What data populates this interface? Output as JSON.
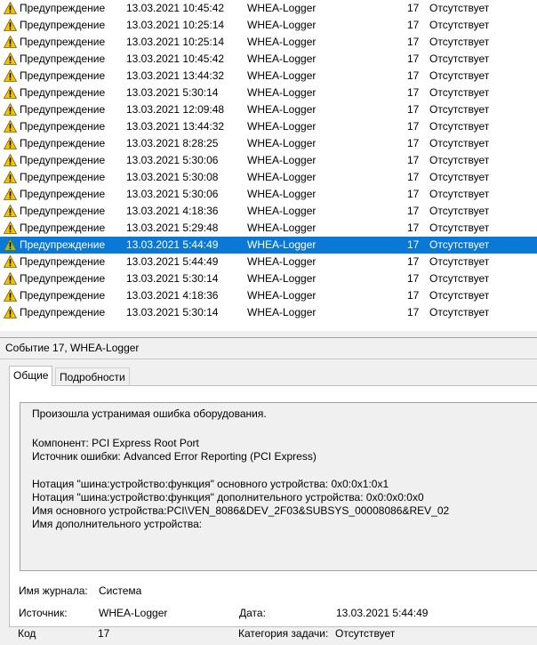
{
  "events": [
    {
      "level": "Предупреждение",
      "date": "13.03.2021 10:45:42",
      "source": "WHEA-Logger",
      "id": "17",
      "task": "Отсутствует",
      "selected": false
    },
    {
      "level": "Предупреждение",
      "date": "13.03.2021 10:25:14",
      "source": "WHEA-Logger",
      "id": "17",
      "task": "Отсутствует",
      "selected": false
    },
    {
      "level": "Предупреждение",
      "date": "13.03.2021 10:25:14",
      "source": "WHEA-Logger",
      "id": "17",
      "task": "Отсутствует",
      "selected": false
    },
    {
      "level": "Предупреждение",
      "date": "13.03.2021 10:45:42",
      "source": "WHEA-Logger",
      "id": "17",
      "task": "Отсутствует",
      "selected": false
    },
    {
      "level": "Предупреждение",
      "date": "13.03.2021 13:44:32",
      "source": "WHEA-Logger",
      "id": "17",
      "task": "Отсутствует",
      "selected": false
    },
    {
      "level": "Предупреждение",
      "date": "13.03.2021 5:30:14",
      "source": "WHEA-Logger",
      "id": "17",
      "task": "Отсутствует",
      "selected": false
    },
    {
      "level": "Предупреждение",
      "date": "13.03.2021 12:09:48",
      "source": "WHEA-Logger",
      "id": "17",
      "task": "Отсутствует",
      "selected": false
    },
    {
      "level": "Предупреждение",
      "date": "13.03.2021 13:44:32",
      "source": "WHEA-Logger",
      "id": "17",
      "task": "Отсутствует",
      "selected": false
    },
    {
      "level": "Предупреждение",
      "date": "13.03.2021 8:28:25",
      "source": "WHEA-Logger",
      "id": "17",
      "task": "Отсутствует",
      "selected": false
    },
    {
      "level": "Предупреждение",
      "date": "13.03.2021 5:30:06",
      "source": "WHEA-Logger",
      "id": "17",
      "task": "Отсутствует",
      "selected": false
    },
    {
      "level": "Предупреждение",
      "date": "13.03.2021 5:30:08",
      "source": "WHEA-Logger",
      "id": "17",
      "task": "Отсутствует",
      "selected": false
    },
    {
      "level": "Предупреждение",
      "date": "13.03.2021 5:30:06",
      "source": "WHEA-Logger",
      "id": "17",
      "task": "Отсутствует",
      "selected": false
    },
    {
      "level": "Предупреждение",
      "date": "13.03.2021 4:18:36",
      "source": "WHEA-Logger",
      "id": "17",
      "task": "Отсутствует",
      "selected": false
    },
    {
      "level": "Предупреждение",
      "date": "13.03.2021 5:29:48",
      "source": "WHEA-Logger",
      "id": "17",
      "task": "Отсутствует",
      "selected": false
    },
    {
      "level": "Предупреждение",
      "date": "13.03.2021 5:44:49",
      "source": "WHEA-Logger",
      "id": "17",
      "task": "Отсутствует",
      "selected": true
    },
    {
      "level": "Предупреждение",
      "date": "13.03.2021 5:44:49",
      "source": "WHEA-Logger",
      "id": "17",
      "task": "Отсутствует",
      "selected": false
    },
    {
      "level": "Предупреждение",
      "date": "13.03.2021 5:30:14",
      "source": "WHEA-Logger",
      "id": "17",
      "task": "Отсутствует",
      "selected": false
    },
    {
      "level": "Предупреждение",
      "date": "13.03.2021 4:18:36",
      "source": "WHEA-Logger",
      "id": "17",
      "task": "Отсутствует",
      "selected": false
    },
    {
      "level": "Предупреждение",
      "date": "13.03.2021 5:30:14",
      "source": "WHEA-Logger",
      "id": "17",
      "task": "Отсутствует",
      "selected": false
    }
  ],
  "icon": "warning-icon",
  "colors": {
    "selection": "#0a78d7",
    "warning": "#f5c400"
  },
  "details": {
    "title": "Событие 17, WHEA-Logger",
    "tabs": {
      "general": "Общие",
      "details": "Подробности"
    },
    "description": {
      "line1": "Произошла устранимая ошибка оборудования.",
      "line2": "Компонент: PCI Express Root Port",
      "line3": "Источник ошибки: Advanced Error Reporting (PCI Express)",
      "line4": "Нотация \"шина:устройство:функция\" основного устройства: 0x0:0x1:0x1",
      "line5": "Нотация \"шина:устройство:функция\" дополнительного устройства: 0x0:0x0:0x0",
      "line6": "Имя основного устройства:PCI\\VEN_8086&DEV_2F03&SUBSYS_00008086&REV_02",
      "line7": "Имя дополнительного устройства:"
    },
    "props": {
      "log_label": "Имя журнала:",
      "log_value": "Система",
      "source_label": "Источник:",
      "source_value": "WHEA-Logger",
      "date_label": "Дата:",
      "date_value": "13.03.2021 5:44:49",
      "code_label": "Код",
      "code_value": "17",
      "category_label": "Категория задачи:",
      "category_value": "Отсутствует"
    }
  }
}
